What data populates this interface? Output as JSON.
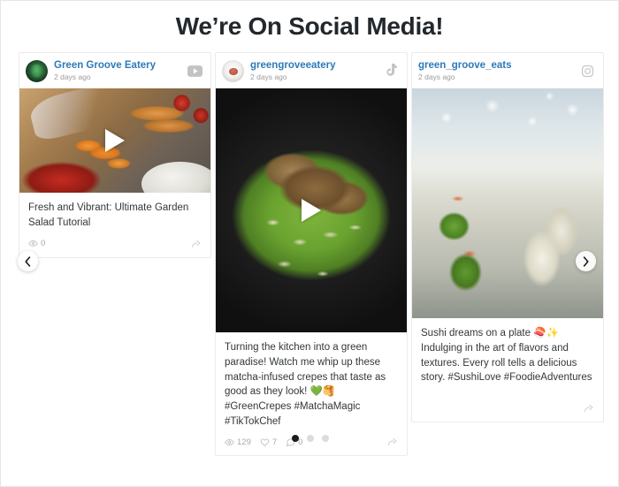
{
  "header": {
    "title": "We’re On Social Media!"
  },
  "carousel": {
    "prev_label": "‹",
    "next_label": "›",
    "dots": [
      {
        "active": true
      },
      {
        "active": false
      },
      {
        "active": false
      }
    ]
  },
  "cards": [
    {
      "network": "youtube",
      "network_icon": "youtube-icon",
      "avatar_icon": "avatar-green-plant",
      "handle": "Green Groove Eatery",
      "timestamp": "2 days ago",
      "media_icon": "play-button-icon",
      "media_alt": "chef slicing carrots on a wooden cutting board with tomatoes",
      "caption": "Fresh and Vibrant: Ultimate Garden Salad Tutorial",
      "stats": [
        {
          "icon": "eye-icon",
          "value": "0"
        }
      ],
      "share_icon": "share-icon"
    },
    {
      "network": "tiktok",
      "network_icon": "tiktok-icon",
      "avatar_icon": "avatar-light-dish",
      "handle": "greengroveeatery",
      "timestamp": "2 days ago",
      "media_icon": "play-button-icon",
      "media_alt": "green matcha crepe topped with almond flakes in a black pan",
      "caption": "Turning the kitchen into a green paradise! Watch me whip up these matcha-infused crepes that taste as good as they look! 💚🥞 #GreenCrepes #MatchaMagic #TikTokChef",
      "stats": [
        {
          "icon": "eye-icon",
          "value": "129"
        },
        {
          "icon": "heart-icon",
          "value": "7"
        },
        {
          "icon": "comment-icon",
          "value": "0"
        }
      ],
      "share_icon": "share-icon"
    },
    {
      "network": "instagram",
      "network_icon": "instagram-icon",
      "avatar_icon": "",
      "handle": "green_groove_eats",
      "timestamp": "2 days ago",
      "media_icon": "",
      "media_alt": "sushi rolls with greens on a plate",
      "caption": "Sushi dreams on a plate 🍣✨ Indulging in the art of flavors and textures. Every roll tells a delicious story. #SushiLove #FoodieAdventures",
      "stats": [],
      "share_icon": "share-icon"
    }
  ],
  "colors": {
    "handle_link": "#2d7ab8",
    "heading": "#23282d",
    "muted": "#9b9b9b",
    "card_border": "#ebebeb",
    "dot_active": "#1b1b1b",
    "dot_inactive": "#dcdcdc"
  }
}
